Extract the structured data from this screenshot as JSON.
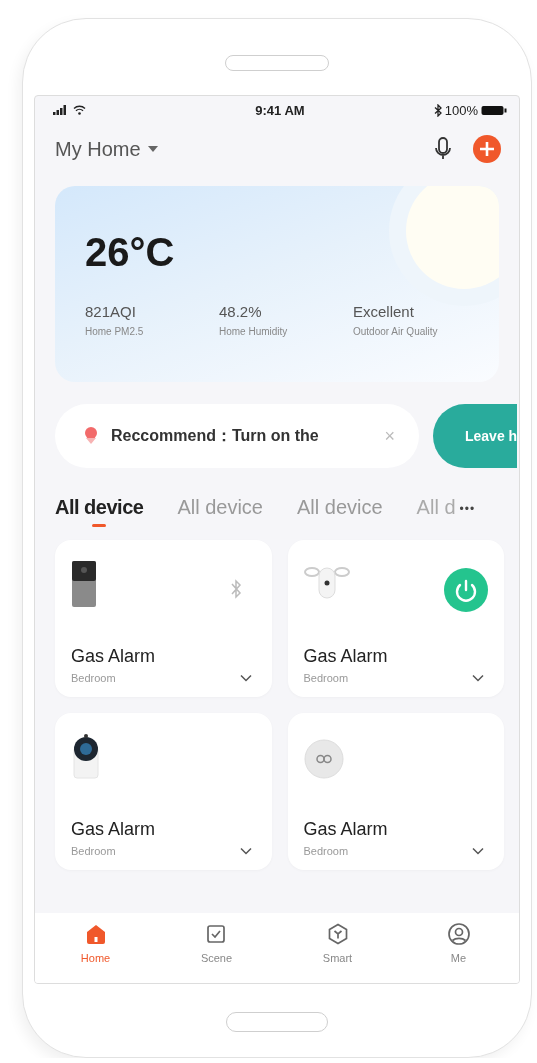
{
  "status_bar": {
    "time": "9:41 AM",
    "battery": "100%"
  },
  "header": {
    "home": "My Home"
  },
  "weather": {
    "temperature": "26°C",
    "stats": [
      {
        "value": "821AQI",
        "label": "Home PM2.5"
      },
      {
        "value": "48.2%",
        "label": "Home Humidity"
      },
      {
        "value": "Excellent",
        "label": "Outdoor Air Quality"
      }
    ]
  },
  "recommendation": {
    "text": "Reccommend：Turn on the",
    "close": "×",
    "action": "Leave h"
  },
  "tabs": [
    {
      "label": "All device",
      "selected": true
    },
    {
      "label": "All device",
      "selected": false
    },
    {
      "label": "All device",
      "selected": false
    },
    {
      "label": "All d",
      "selected": false
    }
  ],
  "tabs_more": "•••",
  "devices": [
    {
      "name": "Gas Alarm",
      "room": "Bedroom",
      "kind": "doorbell"
    },
    {
      "name": "Gas Alarm",
      "room": "Bedroom",
      "kind": "ceiling"
    },
    {
      "name": "Gas Alarm",
      "room": "Bedroom",
      "kind": "camera"
    },
    {
      "name": "Gas Alarm",
      "room": "Bedroom",
      "kind": "sensor"
    }
  ],
  "nav": [
    {
      "label": "Home",
      "kind": "home",
      "selected": true
    },
    {
      "label": "Scene",
      "kind": "scene",
      "selected": false
    },
    {
      "label": "Smart",
      "kind": "smart",
      "selected": false
    },
    {
      "label": "Me",
      "kind": "me",
      "selected": false
    }
  ]
}
